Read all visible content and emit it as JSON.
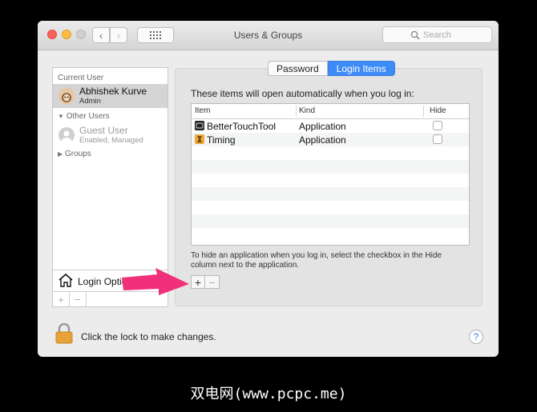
{
  "window": {
    "title": "Users & Groups"
  },
  "toolbar": {
    "back_glyph": "‹",
    "forward_glyph": "›",
    "search_placeholder": "Search"
  },
  "sidebar": {
    "current_user_heading": "Current User",
    "current_user": {
      "name": "Abhishek Kurve",
      "role": "Admin"
    },
    "other_users_heading": "Other Users",
    "guest_user": {
      "name": "Guest User",
      "role": "Enabled, Managed"
    },
    "groups_heading": "Groups",
    "login_options": "Login Options",
    "add_glyph": "+",
    "remove_glyph": "−"
  },
  "tabs": [
    {
      "label": "Password",
      "selected": false
    },
    {
      "label": "Login Items",
      "selected": true
    }
  ],
  "login_items": {
    "intro": "These items will open automatically when you log in:",
    "columns": [
      "Item",
      "Kind",
      "Hide"
    ],
    "rows": [
      {
        "item": "BetterTouchTool",
        "kind": "Application",
        "hide": false,
        "icon": "bettertouchtool-icon"
      },
      {
        "item": "Timing",
        "kind": "Application",
        "hide": false,
        "icon": "timing-icon"
      }
    ],
    "hint_line1": "To hide an application when you log in, select the checkbox in the Hide",
    "hint_line2": "column next to the application.",
    "add_glyph": "+",
    "remove_glyph": "−"
  },
  "footer": {
    "lock_text": "Click the lock to make changes.",
    "help_glyph": "?"
  },
  "watermark": "双电网(www.pcpc.me)",
  "colors": {
    "selected_tab": "#3d8bf6",
    "annotation_arrow": "#f0307a",
    "lock": "#e8a23a"
  }
}
